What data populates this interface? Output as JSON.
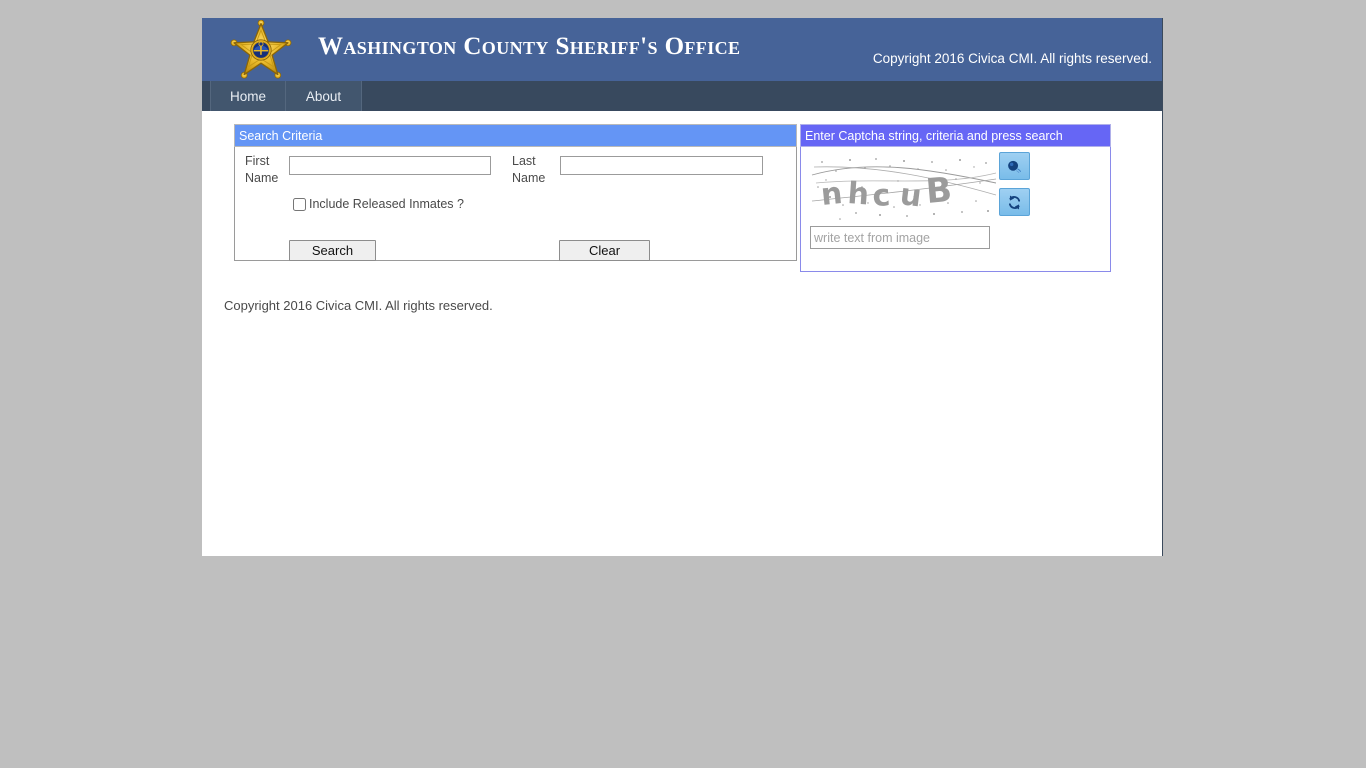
{
  "header": {
    "site_title": "Washington County Sheriff's Office",
    "copyright": "Copyright 2016 Civica CMI. All rights reserved.",
    "logo_icon": "sheriff-star-badge-icon",
    "banner_color": "#466398"
  },
  "nav": {
    "bar_color": "#38495e",
    "items": [
      {
        "label": "Home"
      },
      {
        "label": "About"
      }
    ]
  },
  "search_panel": {
    "header_title": "Search Criteria",
    "header_color": "#6495f5",
    "first_name": {
      "label": "First Name",
      "value": "",
      "placeholder": ""
    },
    "last_name": {
      "label": "Last Name",
      "value": "",
      "placeholder": ""
    },
    "include_released": {
      "label": "Include Released Inmates ?",
      "checked": false
    },
    "search_button_label": "Search",
    "clear_button_label": "Clear"
  },
  "captcha_panel": {
    "header_title": "Enter Captcha string, criteria and press search",
    "header_color": "#6666f5",
    "captcha_text": "nhcuB",
    "audio_button_icon": "speaker-audio-icon",
    "refresh_button_icon": "refresh-reload-icon",
    "input": {
      "value": "",
      "placeholder": "write text from image"
    }
  },
  "footer": {
    "copyright": "Copyright 2016 Civica CMI. All rights reserved."
  }
}
